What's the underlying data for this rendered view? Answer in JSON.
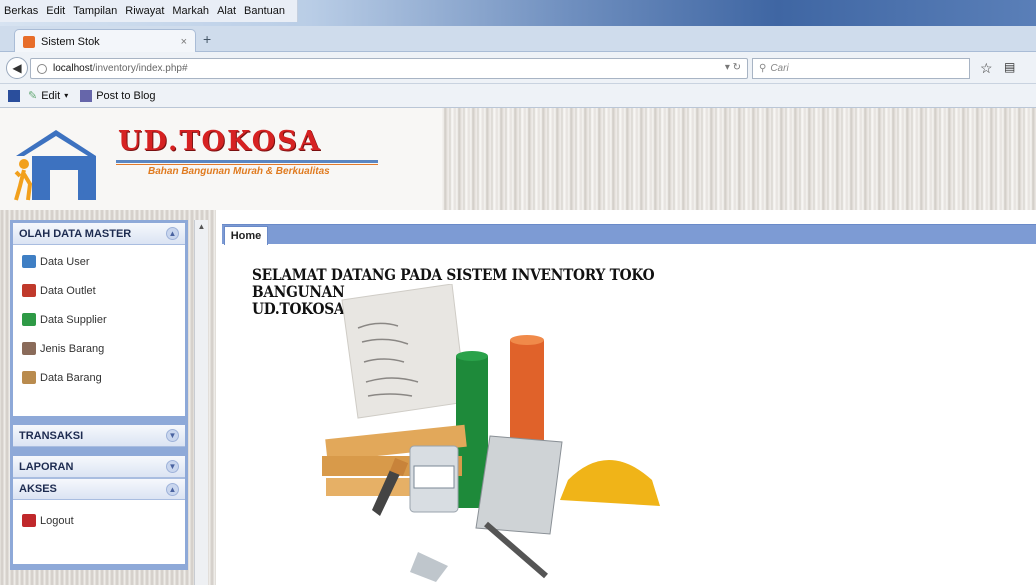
{
  "browser": {
    "menus": [
      "Berkas",
      "Edit",
      "Tampilan",
      "Riwayat",
      "Markah",
      "Alat",
      "Bantuan"
    ],
    "tab_title": "Sistem Stok",
    "tab_close": "×",
    "new_tab": "+",
    "url_host": "localhost",
    "url_path": "/inventory/index.php#",
    "search_placeholder": "Cari",
    "bookmarks": {
      "edit": "Edit",
      "post_to_blog": "Post to Blog"
    }
  },
  "header": {
    "brand": "UD.TOKOSA",
    "tagline": "Bahan Bangunan Murah & Berkualitas"
  },
  "sidebar": {
    "master": {
      "title": "OLAH DATA MASTER",
      "items": [
        {
          "label": "Data User",
          "icon": "users-icon",
          "color": "#3f7fc4"
        },
        {
          "label": "Data Outlet",
          "icon": "store-icon",
          "color": "#c0392b"
        },
        {
          "label": "Data Supplier",
          "icon": "supplier-icon",
          "color": "#2e9a46"
        },
        {
          "label": "Jenis Barang",
          "icon": "box-icon",
          "color": "#8a6b5a"
        },
        {
          "label": "Data Barang",
          "icon": "boxes-icon",
          "color": "#b98b4e"
        }
      ]
    },
    "transaksi": {
      "title": "TRANSAKSI"
    },
    "laporan": {
      "title": "LAPORAN"
    },
    "akses": {
      "title": "AKSES",
      "items": [
        {
          "label": "Logout",
          "icon": "logout-icon",
          "color": "#c0282b"
        }
      ]
    }
  },
  "content": {
    "tab": "Home",
    "welcome_line1": "SELAMAT DATANG PADA SISTEM INVENTORY TOKO BANGUNAN",
    "welcome_line2": "UD.TOKOSA"
  }
}
